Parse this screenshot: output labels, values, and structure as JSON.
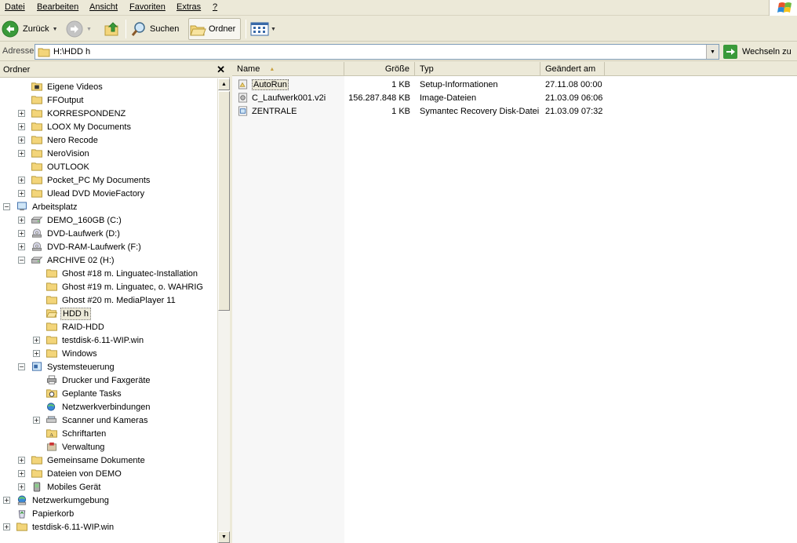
{
  "menu": {
    "items": [
      "Datei",
      "Bearbeiten",
      "Ansicht",
      "Favoriten",
      "Extras",
      "?"
    ]
  },
  "toolbar": {
    "back_label": "Zurück",
    "search_label": "Suchen",
    "folders_label": "Ordner"
  },
  "address": {
    "label": "Adresse",
    "value": "H:\\HDD h",
    "go_label": "Wechseln zu"
  },
  "folder_pane": {
    "title": "Ordner",
    "tree": [
      {
        "label": "Eigene Videos",
        "level": 2,
        "expander": "",
        "icon": "video-folder-icon"
      },
      {
        "label": "FFOutput",
        "level": 2,
        "expander": "",
        "icon": "folder-icon"
      },
      {
        "label": "KORRESPONDENZ",
        "level": 2,
        "expander": "+",
        "icon": "folder-icon"
      },
      {
        "label": "LOOX My Documents",
        "level": 2,
        "expander": "+",
        "icon": "folder-icon"
      },
      {
        "label": "Nero Recode",
        "level": 2,
        "expander": "+",
        "icon": "folder-icon"
      },
      {
        "label": "NeroVision",
        "level": 2,
        "expander": "+",
        "icon": "folder-icon"
      },
      {
        "label": "OUTLOOK",
        "level": 2,
        "expander": "",
        "icon": "folder-icon"
      },
      {
        "label": "Pocket_PC My Documents",
        "level": 2,
        "expander": "+",
        "icon": "folder-icon"
      },
      {
        "label": "Ulead DVD MovieFactory",
        "level": 2,
        "expander": "+",
        "icon": "folder-icon"
      },
      {
        "label": "Arbeitsplatz",
        "level": 1,
        "expander": "-",
        "icon": "computer-icon"
      },
      {
        "label": "DEMO_160GB (C:)",
        "level": 2,
        "expander": "+",
        "icon": "hard-drive-icon"
      },
      {
        "label": "DVD-Laufwerk (D:)",
        "level": 2,
        "expander": "+",
        "icon": "dvd-drive-icon"
      },
      {
        "label": "DVD-RAM-Laufwerk (F:)",
        "level": 2,
        "expander": "+",
        "icon": "dvd-drive-icon"
      },
      {
        "label": "ARCHIVE 02 (H:)",
        "level": 2,
        "expander": "-",
        "icon": "hard-drive-icon"
      },
      {
        "label": "Ghost #18 m. Linguatec-Installation",
        "level": 3,
        "expander": "",
        "icon": "folder-icon"
      },
      {
        "label": "Ghost #19 m. Linguatec, o. WAHRIG",
        "level": 3,
        "expander": "",
        "icon": "folder-icon"
      },
      {
        "label": "Ghost #20 m. MediaPlayer 11",
        "level": 3,
        "expander": "",
        "icon": "folder-icon"
      },
      {
        "label": "HDD h",
        "level": 3,
        "expander": "",
        "icon": "open-folder-icon",
        "selected": true
      },
      {
        "label": "RAID-HDD",
        "level": 3,
        "expander": "",
        "icon": "folder-icon"
      },
      {
        "label": "testdisk-6.11-WIP.win",
        "level": 3,
        "expander": "+",
        "icon": "folder-icon"
      },
      {
        "label": "Windows",
        "level": 3,
        "expander": "+",
        "icon": "folder-icon"
      },
      {
        "label": "Systemsteuerung",
        "level": 2,
        "expander": "-",
        "icon": "control-panel-icon"
      },
      {
        "label": "Drucker und Faxgeräte",
        "level": 3,
        "expander": "",
        "icon": "printer-icon"
      },
      {
        "label": "Geplante Tasks",
        "level": 3,
        "expander": "",
        "icon": "tasks-folder-icon"
      },
      {
        "label": "Netzwerkverbindungen",
        "level": 3,
        "expander": "",
        "icon": "network-icon"
      },
      {
        "label": "Scanner und Kameras",
        "level": 3,
        "expander": "+",
        "icon": "scanner-icon"
      },
      {
        "label": "Schriftarten",
        "level": 3,
        "expander": "",
        "icon": "fonts-folder-icon"
      },
      {
        "label": "Verwaltung",
        "level": 3,
        "expander": "",
        "icon": "admin-tools-icon"
      },
      {
        "label": "Gemeinsame Dokumente",
        "level": 2,
        "expander": "+",
        "icon": "folder-icon"
      },
      {
        "label": "Dateien von DEMO",
        "level": 2,
        "expander": "+",
        "icon": "folder-icon"
      },
      {
        "label": "Mobiles Gerät",
        "level": 2,
        "expander": "+",
        "icon": "mobile-device-icon"
      },
      {
        "label": "Netzwerkumgebung",
        "level": 1,
        "expander": "+",
        "icon": "network-places-icon"
      },
      {
        "label": "Papierkorb",
        "level": 1,
        "expander": "",
        "icon": "recycle-bin-icon"
      },
      {
        "label": "testdisk-6.11-WIP.win",
        "level": 1,
        "expander": "+",
        "icon": "folder-icon"
      }
    ]
  },
  "file_list": {
    "columns": [
      "Name",
      "Größe",
      "Typ",
      "Geändert am"
    ],
    "rows": [
      {
        "name": "AutoRun",
        "size": "1 KB",
        "type": "Setup-Informationen",
        "modified": "27.11.08 00:00",
        "icon": "setup-file-icon",
        "selected": true
      },
      {
        "name": "C_Laufwerk001.v2i",
        "size": "156.287.848 KB",
        "type": "Image-Dateien",
        "modified": "21.03.09 06:06",
        "icon": "image-file-icon"
      },
      {
        "name": "ZENTRALE",
        "size": "1 KB",
        "type": "Symantec Recovery Disk-Datei",
        "modified": "21.03.09 07:32",
        "icon": "recovery-file-icon"
      }
    ]
  },
  "colors": {
    "chrome": "#ece9d8",
    "back_green": "#3a9a3a",
    "folder_yellow": "#f3d57a"
  }
}
